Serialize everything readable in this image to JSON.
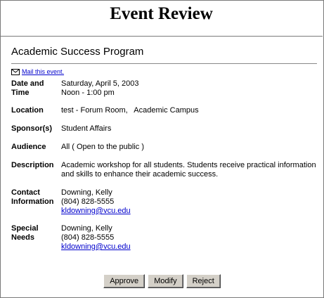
{
  "page": {
    "title": "Event Review"
  },
  "event": {
    "name": "Academic Success Program",
    "mail_link": "Mail this event.",
    "date_label": "Date and Time",
    "date": "Saturday, April 5, 2003",
    "time": "Noon - 1:00 pm",
    "location_label": "Location",
    "location": "test - Forum Room,   Academic Campus",
    "sponsor_label": "Sponsor(s)",
    "sponsor": "Student Affairs",
    "audience_label": "Audience",
    "audience": "All ( Open to the public )",
    "description_label": "Description",
    "description": "Academic workshop for all students. Students receive practical information and skills to enhance their academic success.",
    "contact_label": "Contact Information",
    "contact": {
      "name": "Downing, Kelly",
      "phone": "(804) 828-5555",
      "email": "kldowning@vcu.edu"
    },
    "special_label": "Special Needs",
    "special": {
      "name": "Downing, Kelly",
      "phone": "(804) 828-5555",
      "email": "kldowning@vcu.edu"
    }
  },
  "actions": {
    "approve": "Approve",
    "modify": "Modify",
    "reject": "Reject"
  },
  "icons": {
    "mail": "envelope-icon"
  }
}
